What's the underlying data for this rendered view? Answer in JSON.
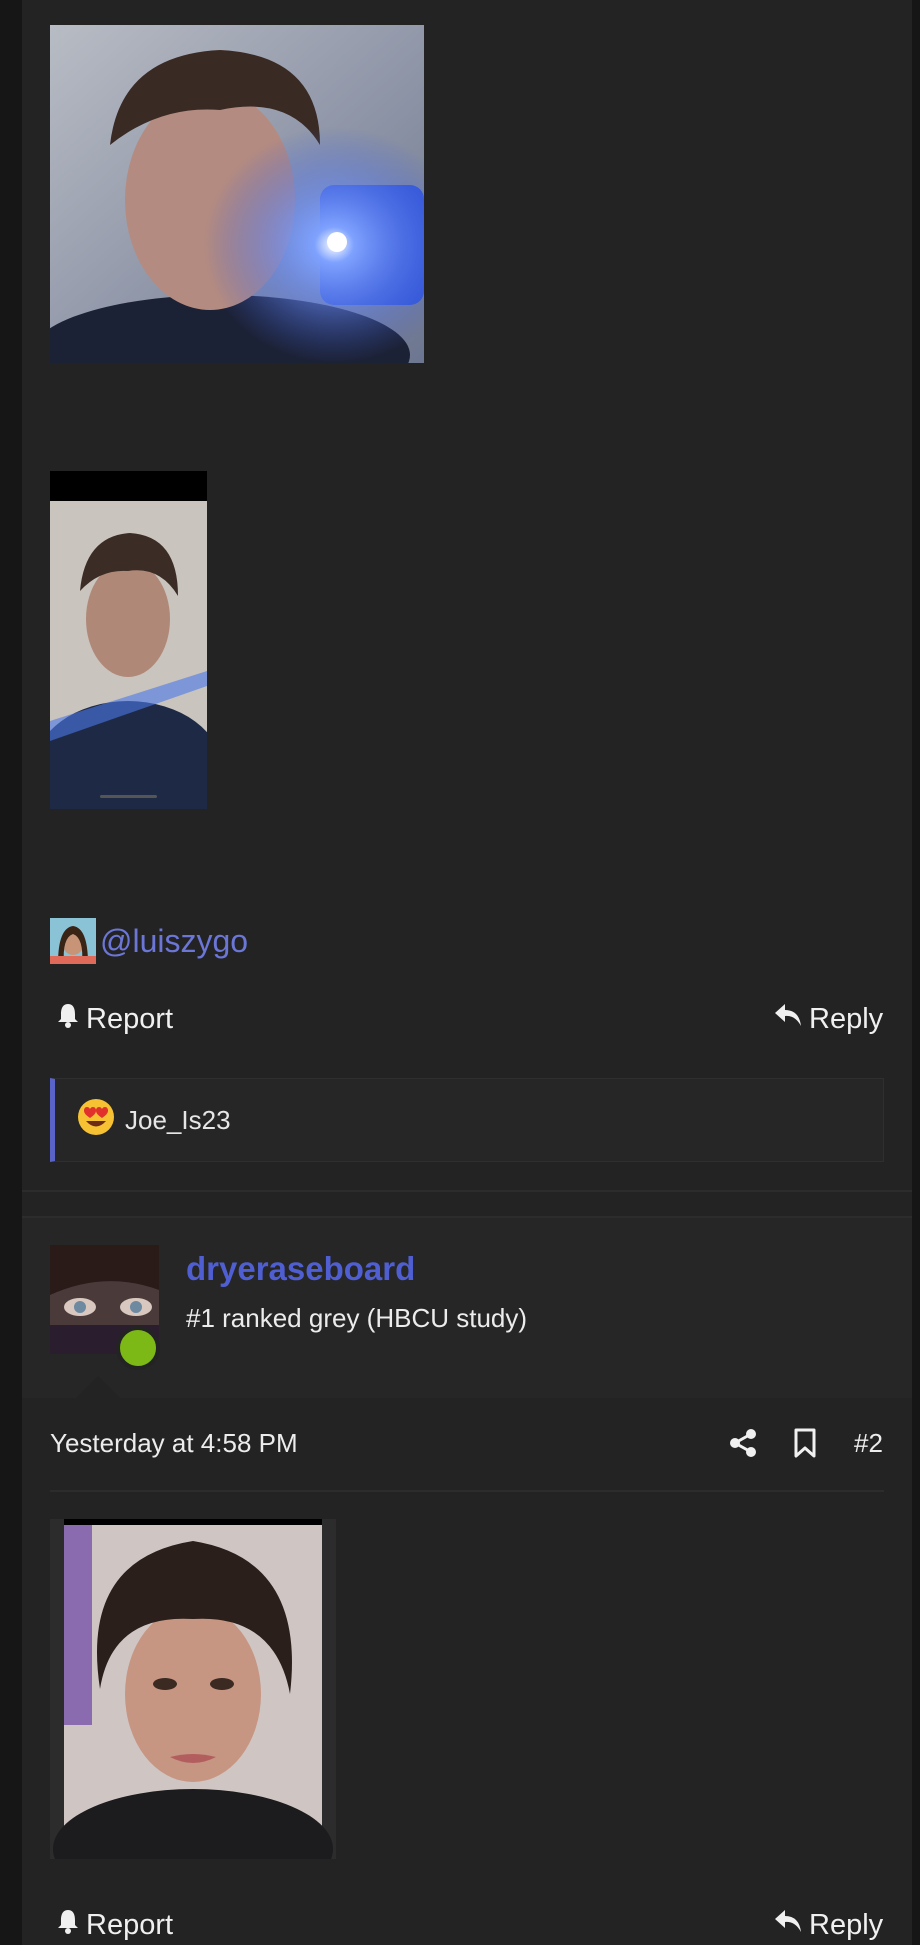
{
  "prior_post": {
    "mention": "@luiszygo",
    "report_label": "Report",
    "reply_label": "Reply",
    "reaction_user": "Joe_Is23",
    "reaction_icon": "heart-eyes-emoji-icon"
  },
  "post": {
    "username": "dryeraseboard",
    "user_title": "#1 ranked grey (HBCU study)",
    "online_status_color": "#7cb916",
    "timestamp": "Yesterday at 4:58 PM",
    "post_number": "#2",
    "report_label": "Report",
    "reply_label": "Reply"
  },
  "colors": {
    "accent": "#5a64c8",
    "username": "#4f5fd2",
    "mention": "#6b76d6"
  }
}
